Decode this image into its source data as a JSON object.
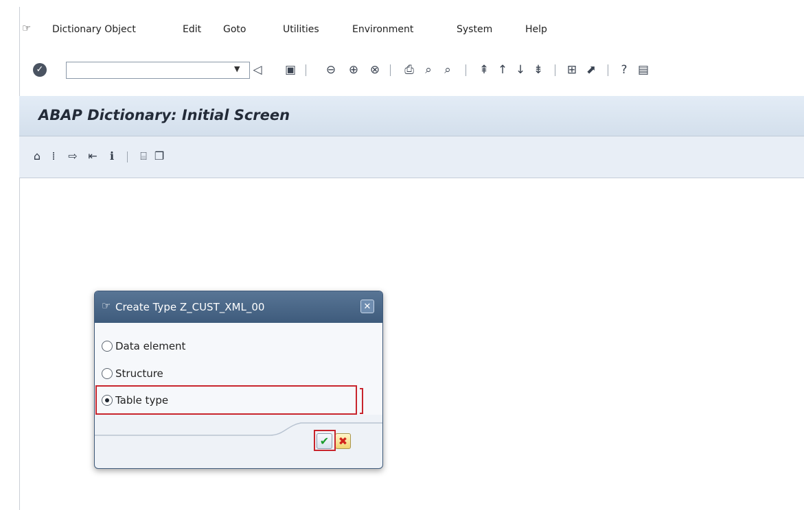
{
  "menu": {
    "icon": "menu-options-icon",
    "items": [
      "Dictionary Object",
      "Edit",
      "Goto",
      "Utilities",
      "Environment",
      "System",
      "Help"
    ]
  },
  "toolbar": {
    "command_field_value": "",
    "icons": [
      "enter-icon",
      "back-triangle-icon",
      "save-icon",
      "back-icon",
      "exit-icon",
      "cancel-icon",
      "print-icon",
      "find-icon",
      "find-next-icon",
      "first-page-icon",
      "previous-page-icon",
      "next-page-icon",
      "last-page-icon",
      "create-session-icon",
      "shortcut-icon",
      "help-icon",
      "customize-layout-icon"
    ]
  },
  "screen": {
    "title": "ABAP Dictionary: Initial Screen"
  },
  "app_toolbar": {
    "icons": [
      "display-object-list-icon",
      "where-used-icon",
      "other-object-icon",
      "check-icon",
      "information-icon",
      "delete-icon",
      "copy-icon"
    ]
  },
  "dialog": {
    "title": "Create Type Z_CUST_XML_00",
    "options": [
      {
        "label": "Data element",
        "selected": false
      },
      {
        "label": "Structure",
        "selected": false
      },
      {
        "label": "Table type",
        "selected": true
      }
    ],
    "ok_icon": "check-mark-icon",
    "cancel_icon": "cancel-x-icon"
  },
  "colors": {
    "dialog_header": "#3e5b7c",
    "highlight": "#c8242c",
    "title_band": "#d3dfec"
  }
}
